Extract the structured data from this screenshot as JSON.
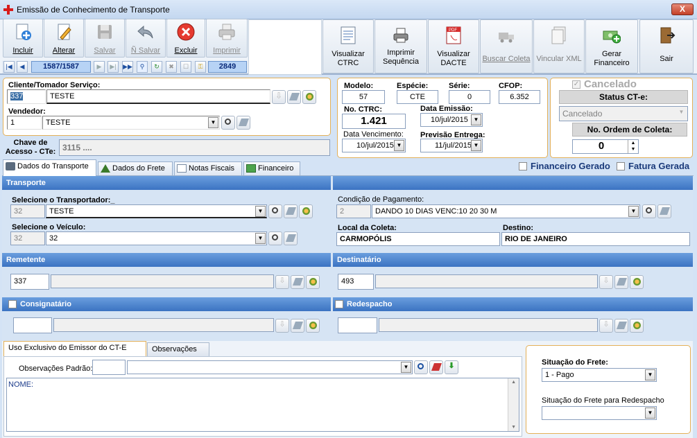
{
  "window": {
    "title": "Emissão de Conhecimento de Transporte",
    "close_label": "X"
  },
  "toolbar": {
    "incluir": "Incluir",
    "alterar": "Alterar",
    "salvar": "Salvar",
    "nsalvar": "Ñ Salvar",
    "excluir": "Excluir",
    "imprimir": "Imprimir",
    "visualizar_ctrc": "Visualizar CTRC",
    "imprimir_sequencia": "Imprimir Sequência",
    "visualizar_dacte": "Visualizar DACTE",
    "buscar_coleta": "Buscar Coleta",
    "vincular_xml": "Vincular XML",
    "gerar_financeiro": "Gerar Financeiro",
    "sair": "Sair",
    "record_position": "1587/1587",
    "record_id": "2849"
  },
  "header": {
    "cliente_label": "Cliente/Tomador Serviço:",
    "cliente_code": "337",
    "cliente_name": "TESTE",
    "vendedor_label": "Vendedor:",
    "vendedor_code": "1",
    "vendedor_name": "TESTE",
    "chave_label": "Chave de Acesso - CTe:",
    "chave_value": "3115 ....",
    "modelo_label": "Modelo:",
    "modelo": "57",
    "especie_label": "Espécie:",
    "especie": "CTE",
    "serie_label": "Série:",
    "serie": "0",
    "cfop_label": "CFOP:",
    "cfop": "6.352",
    "ctrc_label": "No. CTRC:",
    "ctrc": "1.421",
    "data_emissao_label": "Data Emissão:",
    "data_emissao": "10/jul/2015",
    "data_venc_label": "Data Vencimento:",
    "data_venc": "10/jul/2015",
    "previsao_label": "Previsão Entrega:",
    "previsao": "11/jul/2015",
    "cancelado_label": "Cancelado",
    "status_label": "Status CT-e:",
    "status_value": "Cancelado",
    "ordem_label": "No. Ordem de Coleta:",
    "ordem_value": "0"
  },
  "tabs": {
    "t1": "Dados do Transporte",
    "t2": "Dados do Frete",
    "t3": "Notas Fiscais",
    "t4": "Financeiro",
    "fin_gerado": "Financeiro Gerado",
    "fatura_gerada": "Fatura Gerada"
  },
  "transporte": {
    "head": "Transporte",
    "transportador_label": "Selecione o Transportador:_",
    "transportador_code": "32",
    "transportador_name": "TESTE",
    "veiculo_label": "Selecione o Veículo:",
    "veiculo_code": "32",
    "veiculo_name": "32",
    "condicao_label": "Condição de Pagamento:",
    "condicao_code": "2",
    "condicao_name": "DANDO 10 DIAS VENC:10 20 30 M",
    "local_label": "Local da Coleta:",
    "local_value": "CARMOPÓLIS",
    "destino_label": "Destino:",
    "destino_value": "RIO DE JANEIRO"
  },
  "parties": {
    "remetente_head": "Remetente",
    "remetente_code": "337",
    "destinatario_head": "Destinatário",
    "destinatario_code": "493",
    "consignatario_head": "Consignatário",
    "redespacho_head": "Redespacho"
  },
  "bottom": {
    "tab_emissor": "Uso Exclusivo do Emissor do CT-E",
    "tab_obs": "Observações",
    "obs_padrao_label": "Observações Padrão:",
    "obs_text": "NOME:",
    "situacao_label": "Situação do Frete:",
    "situacao_value": "1 - Pago",
    "situacao_red_label": "Situação do Frete para Redespacho",
    "situacao_red_value": ""
  },
  "colors": {
    "accent": "#3b73c2",
    "panel_border": "#e4b057",
    "bg": "#d4e3f5"
  }
}
